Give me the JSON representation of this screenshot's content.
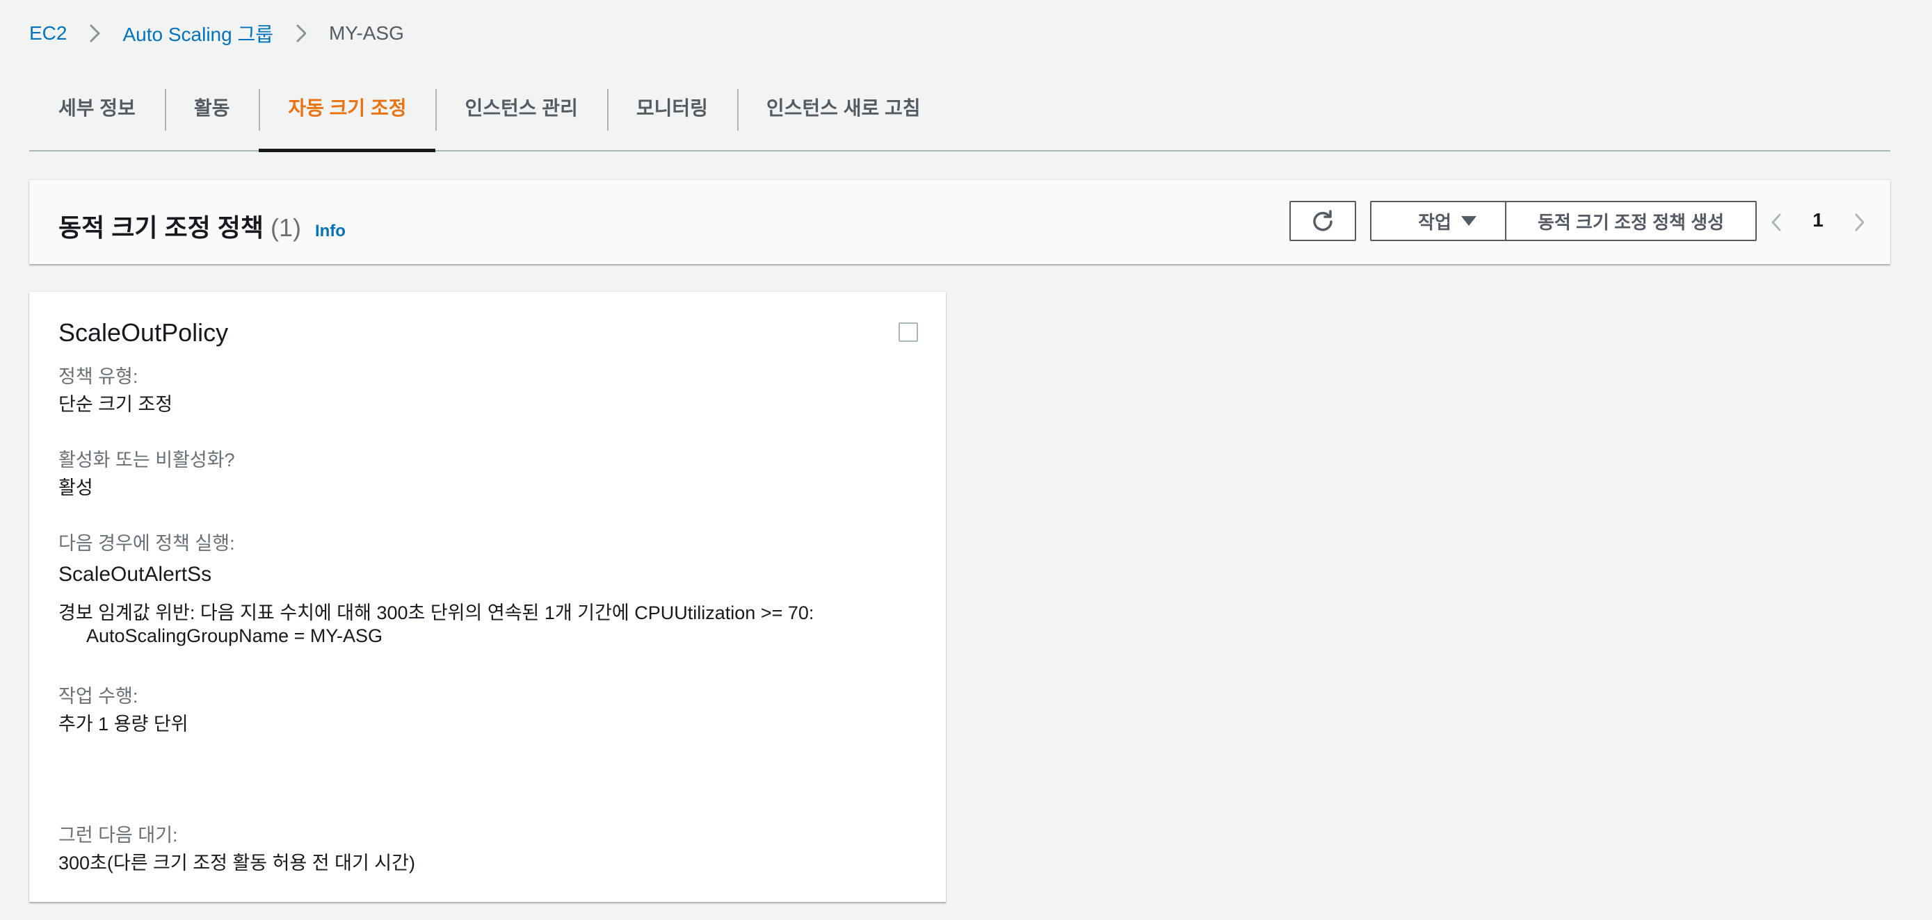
{
  "breadcrumb": {
    "items": [
      "EC2",
      "Auto Scaling 그룹"
    ],
    "current": "MY-ASG"
  },
  "tabs": [
    {
      "label": "세부 정보",
      "active": false
    },
    {
      "label": "활동",
      "active": false
    },
    {
      "label": "자동 크기 조정",
      "active": true
    },
    {
      "label": "인스턴스 관리",
      "active": false
    },
    {
      "label": "모니터링",
      "active": false
    },
    {
      "label": "인스턴스 새로 고침",
      "active": false
    }
  ],
  "panel": {
    "title": "동적 크기 조정 정책",
    "count": "(1)",
    "info": "Info",
    "actions_label": "작업",
    "create_label": "동적 크기 조정 정책 생성",
    "page_number": "1"
  },
  "policy": {
    "name": "ScaleOutPolicy",
    "type_label": "정책 유형:",
    "type_value": "단순 크기 조정",
    "enabled_label": "활성화 또는 비활성화?",
    "enabled_value": "활성",
    "execute_label": "다음 경우에 정책 실행:",
    "alarm_name": "ScaleOutAlertSs",
    "alarm_desc_line1": "경보 임계값 위반: 다음 지표 수치에 대해 300초 단위의 연속된 1개 기간에 CPUUtilization >= 70:",
    "alarm_desc_line2": "AutoScalingGroupName = MY-ASG",
    "action_label": "작업 수행:",
    "action_value": "추가 1 용량 단위",
    "wait_label": "그런 다음 대기:",
    "wait_value": "300초(다른 크기 조정 활동 허용 전 대기 시간)"
  },
  "colors": {
    "link": "#0073bb",
    "active_tab": "#ec7211",
    "text": "#16191f",
    "muted": "#687078",
    "background": "#f2f3f3"
  },
  "icons": [
    "chevron-right-icon",
    "refresh-icon",
    "caret-down-icon",
    "chevron-left-icon"
  ]
}
